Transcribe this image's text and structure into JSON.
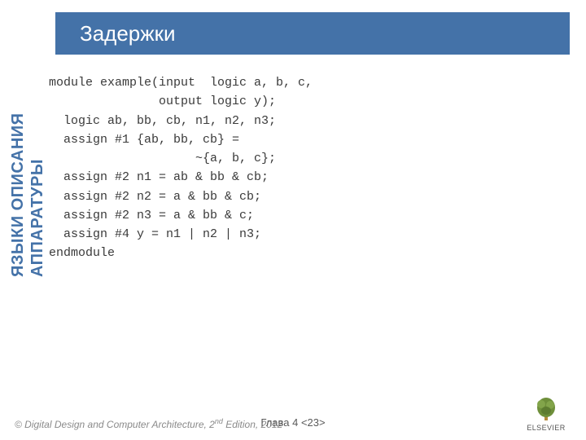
{
  "title": "Задержки",
  "sidebar_line1": "ЯЗЫКИ ОПИСАНИЯ",
  "sidebar_line2": "АППАРАТУРЫ",
  "code": {
    "l1": "module example(input  logic a, b, c,",
    "l2": "               output logic y);",
    "l3": "  logic ab, bb, cb, n1, n2, n3;",
    "l4": "  assign #1 {ab, bb, cb} =",
    "l5": "                    ~{a, b, c};",
    "l6": "  assign #2 n1 = ab & bb & cb;",
    "l7": "  assign #2 n2 = a & bb & cb;",
    "l8": "  assign #2 n3 = a & bb & c;",
    "l9": "  assign #4 y = n1 | n2 | n3;",
    "l10": "endmodule"
  },
  "footer": {
    "copyright_prefix": "© Digital Design and Computer Architecture, ",
    "edition_num": "2",
    "edition_suffix": "nd",
    "copyright_rest": " Edition, 2012"
  },
  "chapter": "Глава 4 <23>",
  "publisher": "ELSEVIER"
}
